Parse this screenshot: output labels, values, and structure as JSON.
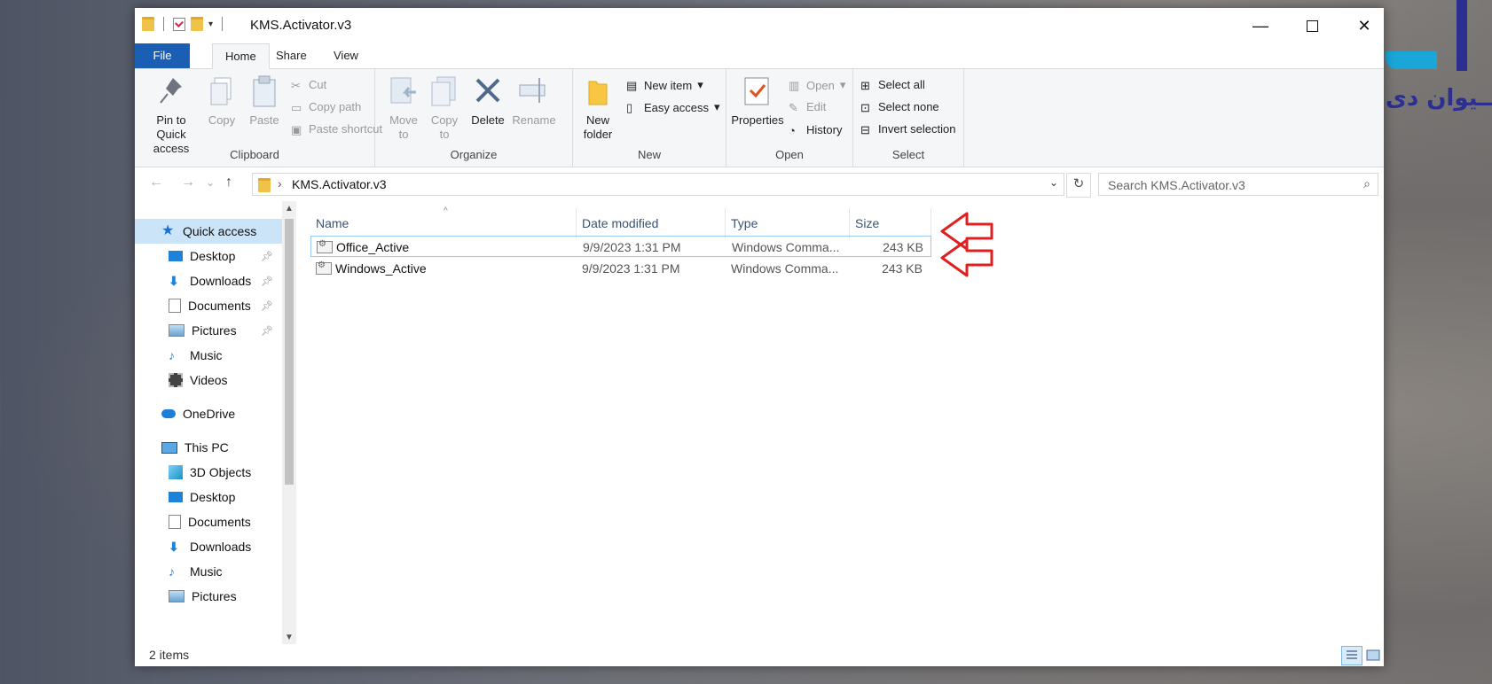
{
  "background_logo_text": "ســیوان دی",
  "window": {
    "title": "KMS.Activator.v3",
    "controls": {
      "minimize": "—",
      "maximize": "",
      "close": "✕"
    }
  },
  "ribbon_tabs": [
    "File",
    "Home",
    "Share",
    "View"
  ],
  "help_label": "?",
  "ribbon": {
    "clipboard": {
      "label": "Clipboard",
      "pin": "Pin to Quick access",
      "copy": "Copy",
      "paste": "Paste",
      "cut": "Cut",
      "copy_path": "Copy path",
      "paste_shortcut": "Paste shortcut"
    },
    "organize": {
      "label": "Organize",
      "move_to": "Move to",
      "copy_to": "Copy to",
      "delete": "Delete",
      "rename": "Rename"
    },
    "new": {
      "label": "New",
      "new_folder": "New folder",
      "new_item": "New item",
      "easy_access": "Easy access"
    },
    "open": {
      "label": "Open",
      "properties": "Properties",
      "open": "Open",
      "edit": "Edit",
      "history": "History"
    },
    "select": {
      "label": "Select",
      "select_all": "Select all",
      "select_none": "Select none",
      "invert_selection": "Invert selection"
    }
  },
  "address": {
    "path": "KMS.Activator.v3",
    "search_placeholder": "Search KMS.Activator.v3"
  },
  "nav_pane": {
    "quick_access": "Quick access",
    "quick_items": [
      "Desktop",
      "Downloads",
      "Documents",
      "Pictures",
      "Music",
      "Videos"
    ],
    "onedrive": "OneDrive",
    "this_pc": "This PC",
    "pc_items": [
      "3D Objects",
      "Desktop",
      "Documents",
      "Downloads",
      "Music",
      "Pictures"
    ]
  },
  "columns": [
    "Name",
    "Date modified",
    "Type",
    "Size"
  ],
  "files": [
    {
      "name": "Office_Active",
      "date": "9/9/2023 1:31 PM",
      "type": "Windows Comma...",
      "size": "243 KB"
    },
    {
      "name": "Windows_Active",
      "date": "9/9/2023 1:31 PM",
      "type": "Windows Comma...",
      "size": "243 KB"
    }
  ],
  "status": {
    "count": "2 items"
  },
  "colors": {
    "accent": "#1a5fb4",
    "selection": "#cce4f7",
    "annotation_arrow": "#e02020"
  }
}
